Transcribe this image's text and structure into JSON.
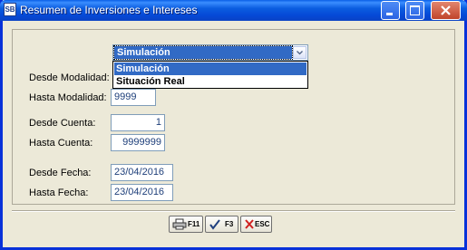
{
  "window": {
    "title": "Resumen de Inversiones e Intereses",
    "app_icon_text": "SB"
  },
  "filter": {
    "mode_selected": "Simulación",
    "mode_options": [
      "Simulación",
      "Situación Real"
    ]
  },
  "labels": {
    "desde_modalidad": "Desde Modalidad:",
    "hasta_modalidad": "Hasta Modalidad:",
    "desde_cuenta": "Desde Cuenta:",
    "hasta_cuenta": "Hasta Cuenta:",
    "desde_fecha": "Desde Fecha:",
    "hasta_fecha": "Hasta Fecha:"
  },
  "values": {
    "hasta_modalidad": "9999",
    "desde_cuenta": "1",
    "hasta_cuenta": "9999999",
    "desde_fecha": "23/04/2016",
    "hasta_fecha": "23/04/2016"
  },
  "buttons": {
    "print": "F11",
    "accept": "F3",
    "cancel": "ESC"
  },
  "icons": {
    "app": "sb-logo-icon",
    "minimize": "minimize-icon",
    "maximize": "maximize-icon",
    "close": "close-icon",
    "dropdown": "chevron-down-icon",
    "print": "printer-icon",
    "accept": "checkmark-icon",
    "cancel": "x-icon"
  },
  "colors": {
    "titlebar": "#0a5fe5",
    "selection": "#316ac5",
    "field_text": "#1e3f7a"
  }
}
